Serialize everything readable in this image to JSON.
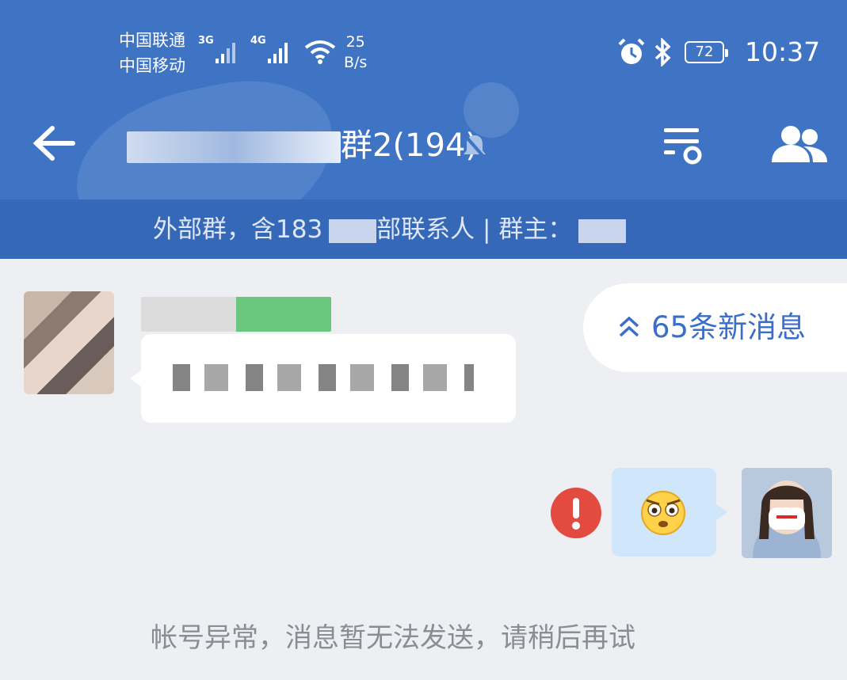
{
  "status_bar": {
    "carrier1": "中国联通",
    "carrier2": "中国移动",
    "sim1_net": "3G",
    "sim2_net": "4G",
    "speed_value": "25",
    "speed_unit": "B/s",
    "battery": "72",
    "time": "10:37"
  },
  "header": {
    "title": "群2(194)",
    "subtitle": "外部群，含183",
    "subtitle_tail": "部联系人 | 群主：",
    "muted_icon": "bell-mute-icon",
    "menu_icon": "group-settings-icon",
    "members_icon": "group-members-icon"
  },
  "chat": {
    "new_messages": "65条新消息",
    "notice": "帐号异常，消息暂无法发送，请稍后再试",
    "sent_emoji": "surprised-face-emoji",
    "error_icon": "exclamation-icon"
  },
  "colors": {
    "header_blue": "#3f74c4",
    "accent_blue": "#3a6ec8",
    "error_red": "#e34a40",
    "sent_bubble": "#cfe6fb"
  }
}
